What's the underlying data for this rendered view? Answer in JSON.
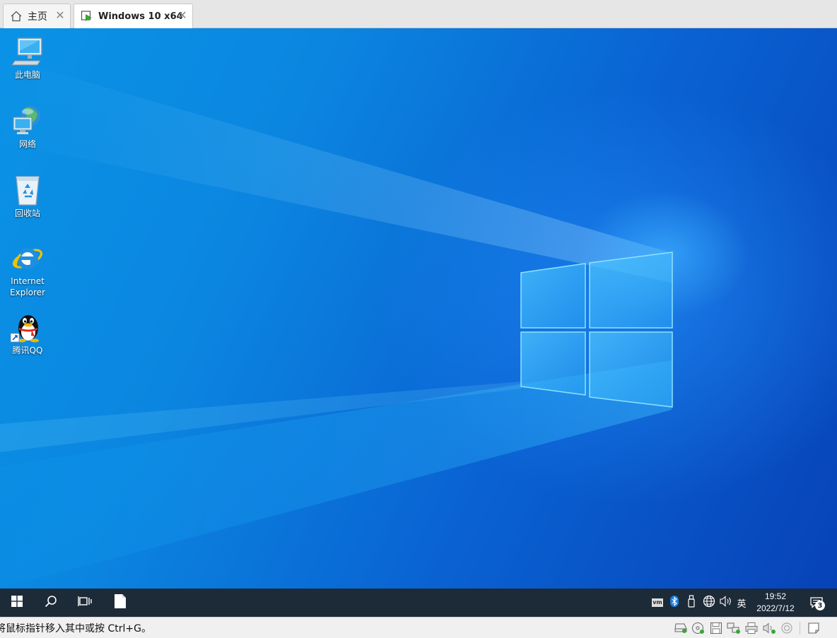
{
  "tabs": [
    {
      "label": "主页",
      "icon": "home-icon"
    },
    {
      "label": "Windows 10 x64",
      "icon": "vm-running-icon"
    }
  ],
  "desktop": {
    "icons": [
      {
        "label": "此电脑",
        "icon": "computer-icon"
      },
      {
        "label": "网络",
        "icon": "network-icon"
      },
      {
        "label": "回收站",
        "icon": "recycle-bin-icon"
      },
      {
        "label": "Internet Explorer",
        "icon": "internet-explorer-icon"
      },
      {
        "label": "腾讯QQ",
        "icon": "qq-icon"
      }
    ]
  },
  "taskbar": {
    "start_icon": "windows-start-icon",
    "search_icon": "search-icon",
    "task_view_icon": "task-view-icon",
    "pinned_icon": "document-icon",
    "tray": {
      "ime": "英",
      "time": "19:52",
      "date": "2022/7/12",
      "notification_count": "3",
      "vm_label": "vm"
    }
  },
  "statusbar": {
    "message": "将鼠标指针移入其中或按 Ctrl+G。"
  },
  "colors": {
    "desktop_accent": "#0a78e0",
    "taskbar_bg": "#1d2a38",
    "tab_bar_bg": "#e6e6e6"
  }
}
